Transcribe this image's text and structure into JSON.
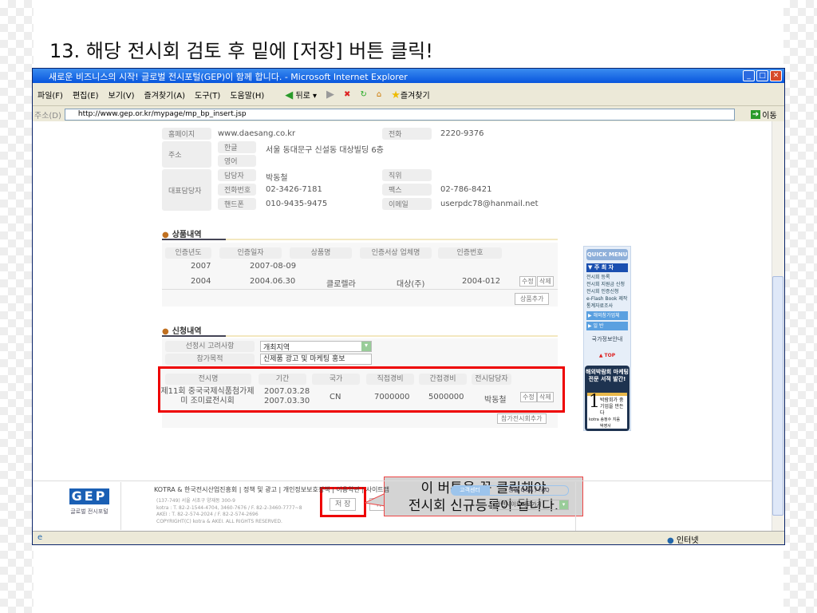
{
  "slide_title": "13. 해당 전시회 검토 후 밑에 [저장] 버튼 클릭!",
  "window": {
    "title": "새로운 비즈니스의 시작! 글로벌 전시포털(GEP)이 함께 합니다. - Microsoft Internet Explorer",
    "menu": [
      "파일(F)",
      "편집(E)",
      "보기(V)",
      "즐겨찾기(A)",
      "도구(T)",
      "도움말(H)"
    ],
    "back_label": "뒤로",
    "favorites_label": "즐겨찾기",
    "address_label": "주소(D)",
    "url": "http://www.gep.or.kr/mypage/mp_bp_insert.jsp",
    "go_label": "이동",
    "status_zone": "인터넷"
  },
  "company": {
    "homepage_label": "홈페이지",
    "homepage": "www.daesang.co.kr",
    "phone_label": "전화",
    "phone": "2220-9376",
    "address_label": "주소",
    "korean_label": "한글",
    "korean_address": "서울 동대문구 신설동 대상빌딩 6층",
    "english_label": "영어",
    "rep_label": "대표담당자",
    "contact_label": "담당자",
    "contact": "박동철",
    "position_label": "직위",
    "tel_label": "전화번호",
    "tel": "02-3426-7181",
    "fax_label": "팩스",
    "fax": "02-786-8421",
    "mobile_label": "핸드폰",
    "mobile": "010-9435-9475",
    "email_label": "이메일",
    "email": "userpdc78@hanmail.net"
  },
  "products": {
    "title": "상품내역",
    "headers": [
      "인증년도",
      "인증일자",
      "상품명",
      "인증서상 업체명",
      "인증번호"
    ],
    "rows": [
      [
        "2007",
        "2007-08-09",
        "",
        "",
        ""
      ],
      [
        "2004",
        "2004.06.30",
        "클로렐라",
        "대상(주)",
        "2004-012"
      ]
    ],
    "edit": "수정",
    "delete": "삭제",
    "add": "상품추가"
  },
  "application": {
    "title": "신청내역",
    "consider_label": "선정시 고려사항",
    "consider_value": "개최지역",
    "purpose_label": "참가목적",
    "purpose_value": "신제품 광고 및 마케팅 홍보",
    "headers": [
      "전시명",
      "기간",
      "국가",
      "직접경비",
      "간접경비",
      "전시담당자"
    ],
    "row": {
      "name1": "제11회 중국국제식품첨가제",
      "name2": "미 조미료전시회",
      "start": "2007.03.28",
      "end": "2007.03.30",
      "country": "CN",
      "direct": "7000000",
      "indirect": "5000000",
      "manager": "박동철"
    },
    "edit": "수정",
    "delete": "삭제",
    "add": "참가전시회추가"
  },
  "save_label": "저 장",
  "cancel_label": "취 소",
  "callout": {
    "line1": "이 버튼을 꼭 클릭해야",
    "line2": "전시회 신규등록이 됩니다."
  },
  "quick_menu": {
    "title": "QUICK MENU",
    "main": "▼ 주 최 자",
    "items": [
      "전시회 등록",
      "전시회 지원금 신청",
      "전시회 인증신청",
      "e-Flash Book 제작",
      "통계자료조사"
    ],
    "overseas": "▶ 해외참가업체",
    "general": "▶ 일  반",
    "national": "국가정보안내",
    "top": "▲ TOP",
    "ad_title": "해외박람회 마케팅 전문 서적 발간!",
    "ad_book": "박람회가 중기업을 만든다",
    "ad_author": "kotra 송정수 지음",
    "ad_pub": "박영사"
  },
  "footer": {
    "logo": "GEP",
    "logo_sub": "글로벌 전시포털",
    "links": "KOTRA & 한국전시산업진흥회 | 정책 및 광고 | 개인정보보호정책 | 이용약관 | 사이트맵",
    "addr": "(137-749) 서울 서초구 양재동 300-9",
    "kotra": "kotra : T. 82-2-1544-4704, 3460-7676 / F. 82-2-3460-7777~8",
    "akei": "AKEI : T. 82-2-574-2024 / F. 82-2-574-2696",
    "copy": "COPYRIGHT(C) kotra & AKEI. ALL RIGHTS RESERVED.",
    "cs": "고객센터",
    "qa": "통합 Q&A / FAQ",
    "related": "관련사이트바로가기"
  }
}
